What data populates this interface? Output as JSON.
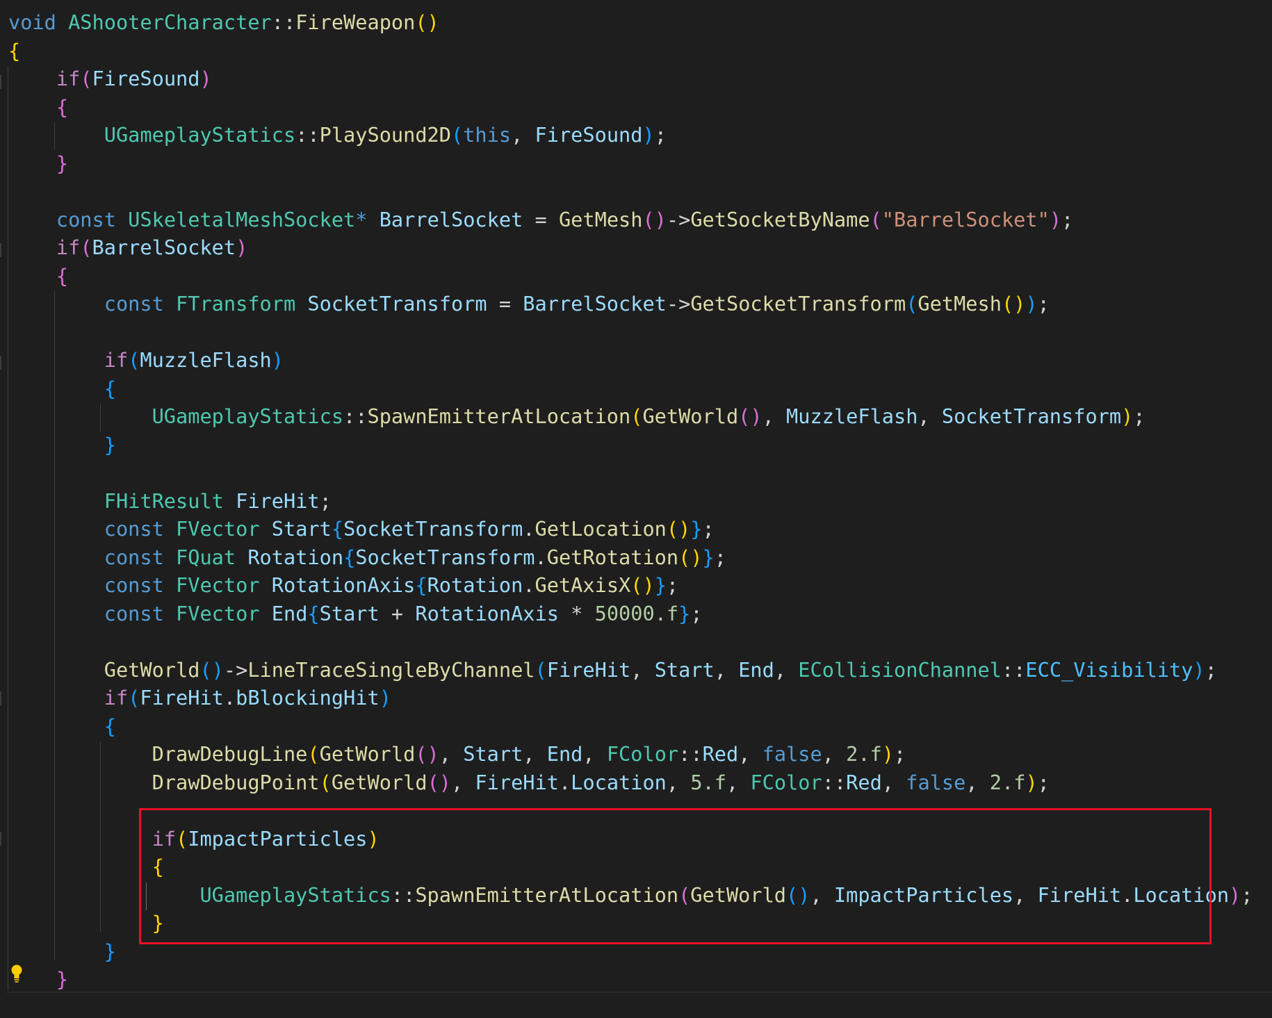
{
  "editor": {
    "theme": "dark",
    "colors": {
      "background": "#1e1e1e",
      "keyword": "#569cd6",
      "control": "#c586c0",
      "type": "#4ec9b0",
      "function": "#dcdcaa",
      "variable": "#9cdcfe",
      "enum_member": "#4fc1ff",
      "string": "#ce9178",
      "number": "#b5cea8",
      "bracket_level_1": "#ffd700",
      "bracket_level_2": "#da70d6",
      "bracket_level_3": "#179fff",
      "highlight_box": "#e81123"
    },
    "highlight_box": {
      "label": "red-highlight-box",
      "first_line": 29,
      "last_line": 32
    },
    "gutter_icon": "lightbulb-icon",
    "lines": [
      [
        [
          "kw",
          "void"
        ],
        [
          "op",
          " "
        ],
        [
          "type",
          "AShooterCharacter"
        ],
        [
          "op",
          "::"
        ],
        [
          "fn",
          "FireWeapon"
        ],
        [
          "b1",
          "()"
        ]
      ],
      [
        [
          "b1",
          "{"
        ]
      ],
      [
        [
          "op",
          "    "
        ],
        [
          "ctl",
          "if"
        ],
        [
          "b2",
          "("
        ],
        [
          "var",
          "FireSound"
        ],
        [
          "b2",
          ")"
        ]
      ],
      [
        [
          "op",
          "    "
        ],
        [
          "b2",
          "{"
        ]
      ],
      [
        [
          "op",
          "        "
        ],
        [
          "type",
          "UGameplayStatics"
        ],
        [
          "op",
          "::"
        ],
        [
          "fn",
          "PlaySound2D"
        ],
        [
          "b3",
          "("
        ],
        [
          "kw",
          "this"
        ],
        [
          "pun",
          ", "
        ],
        [
          "var",
          "FireSound"
        ],
        [
          "b3",
          ")"
        ],
        [
          "pun",
          ";"
        ]
      ],
      [
        [
          "op",
          "    "
        ],
        [
          "b2",
          "}"
        ]
      ],
      [],
      [
        [
          "op",
          "    "
        ],
        [
          "kw",
          "const"
        ],
        [
          "op",
          " "
        ],
        [
          "type",
          "USkeletalMeshSocket"
        ],
        [
          "kw",
          "*"
        ],
        [
          "op",
          " "
        ],
        [
          "var",
          "BarrelSocket"
        ],
        [
          "op",
          " = "
        ],
        [
          "fn",
          "GetMesh"
        ],
        [
          "b2",
          "()"
        ],
        [
          "op",
          "->"
        ],
        [
          "fn",
          "GetSocketByName"
        ],
        [
          "b2",
          "("
        ],
        [
          "str",
          "\"BarrelSocket\""
        ],
        [
          "b2",
          ")"
        ],
        [
          "pun",
          ";"
        ]
      ],
      [
        [
          "op",
          "    "
        ],
        [
          "ctl",
          "if"
        ],
        [
          "b2",
          "("
        ],
        [
          "var",
          "BarrelSocket"
        ],
        [
          "b2",
          ")"
        ]
      ],
      [
        [
          "op",
          "    "
        ],
        [
          "b2",
          "{"
        ]
      ],
      [
        [
          "op",
          "        "
        ],
        [
          "kw",
          "const"
        ],
        [
          "op",
          " "
        ],
        [
          "type",
          "FTransform"
        ],
        [
          "op",
          " "
        ],
        [
          "var",
          "SocketTransform"
        ],
        [
          "op",
          " = "
        ],
        [
          "var",
          "BarrelSocket"
        ],
        [
          "op",
          "->"
        ],
        [
          "fn",
          "GetSocketTransform"
        ],
        [
          "b3",
          "("
        ],
        [
          "fn",
          "GetMesh"
        ],
        [
          "b1",
          "()"
        ],
        [
          "b3",
          ")"
        ],
        [
          "pun",
          ";"
        ]
      ],
      [],
      [
        [
          "op",
          "        "
        ],
        [
          "ctl",
          "if"
        ],
        [
          "b3",
          "("
        ],
        [
          "var",
          "MuzzleFlash"
        ],
        [
          "b3",
          ")"
        ]
      ],
      [
        [
          "op",
          "        "
        ],
        [
          "b3",
          "{"
        ]
      ],
      [
        [
          "op",
          "            "
        ],
        [
          "type",
          "UGameplayStatics"
        ],
        [
          "op",
          "::"
        ],
        [
          "fn",
          "SpawnEmitterAtLocation"
        ],
        [
          "b1",
          "("
        ],
        [
          "fn",
          "GetWorld"
        ],
        [
          "b2",
          "()"
        ],
        [
          "pun",
          ", "
        ],
        [
          "var",
          "MuzzleFlash"
        ],
        [
          "pun",
          ", "
        ],
        [
          "var",
          "SocketTransform"
        ],
        [
          "b1",
          ")"
        ],
        [
          "pun",
          ";"
        ]
      ],
      [
        [
          "op",
          "        "
        ],
        [
          "b3",
          "}"
        ]
      ],
      [],
      [
        [
          "op",
          "        "
        ],
        [
          "type",
          "FHitResult"
        ],
        [
          "op",
          " "
        ],
        [
          "var",
          "FireHit"
        ],
        [
          "pun",
          ";"
        ]
      ],
      [
        [
          "op",
          "        "
        ],
        [
          "kw",
          "const"
        ],
        [
          "op",
          " "
        ],
        [
          "type",
          "FVector"
        ],
        [
          "op",
          " "
        ],
        [
          "var",
          "Start"
        ],
        [
          "b3",
          "{"
        ],
        [
          "var",
          "SocketTransform"
        ],
        [
          "op",
          "."
        ],
        [
          "fn",
          "GetLocation"
        ],
        [
          "b1",
          "()"
        ],
        [
          "b3",
          "}"
        ],
        [
          "pun",
          ";"
        ]
      ],
      [
        [
          "op",
          "        "
        ],
        [
          "kw",
          "const"
        ],
        [
          "op",
          " "
        ],
        [
          "type",
          "FQuat"
        ],
        [
          "op",
          " "
        ],
        [
          "var",
          "Rotation"
        ],
        [
          "b3",
          "{"
        ],
        [
          "var",
          "SocketTransform"
        ],
        [
          "op",
          "."
        ],
        [
          "fn",
          "GetRotation"
        ],
        [
          "b1",
          "()"
        ],
        [
          "b3",
          "}"
        ],
        [
          "pun",
          ";"
        ]
      ],
      [
        [
          "op",
          "        "
        ],
        [
          "kw",
          "const"
        ],
        [
          "op",
          " "
        ],
        [
          "type",
          "FVector"
        ],
        [
          "op",
          " "
        ],
        [
          "var",
          "RotationAxis"
        ],
        [
          "b3",
          "{"
        ],
        [
          "var",
          "Rotation"
        ],
        [
          "op",
          "."
        ],
        [
          "fn",
          "GetAxisX"
        ],
        [
          "b1",
          "()"
        ],
        [
          "b3",
          "}"
        ],
        [
          "pun",
          ";"
        ]
      ],
      [
        [
          "op",
          "        "
        ],
        [
          "kw",
          "const"
        ],
        [
          "op",
          " "
        ],
        [
          "type",
          "FVector"
        ],
        [
          "op",
          " "
        ],
        [
          "var",
          "End"
        ],
        [
          "b3",
          "{"
        ],
        [
          "var",
          "Start"
        ],
        [
          "op",
          " + "
        ],
        [
          "var",
          "RotationAxis"
        ],
        [
          "op",
          " * "
        ],
        [
          "num",
          "50000.f"
        ],
        [
          "b3",
          "}"
        ],
        [
          "pun",
          ";"
        ]
      ],
      [],
      [
        [
          "op",
          "        "
        ],
        [
          "fn",
          "GetWorld"
        ],
        [
          "b3",
          "()"
        ],
        [
          "op",
          "->"
        ],
        [
          "fn",
          "LineTraceSingleByChannel"
        ],
        [
          "b3",
          "("
        ],
        [
          "var",
          "FireHit"
        ],
        [
          "pun",
          ", "
        ],
        [
          "var",
          "Start"
        ],
        [
          "pun",
          ", "
        ],
        [
          "var",
          "End"
        ],
        [
          "pun",
          ", "
        ],
        [
          "type",
          "ECollisionChannel"
        ],
        [
          "op",
          "::"
        ],
        [
          "enumv",
          "ECC_Visibility"
        ],
        [
          "b3",
          ")"
        ],
        [
          "pun",
          ";"
        ]
      ],
      [
        [
          "op",
          "        "
        ],
        [
          "ctl",
          "if"
        ],
        [
          "b3",
          "("
        ],
        [
          "var",
          "FireHit"
        ],
        [
          "op",
          "."
        ],
        [
          "var",
          "bBlockingHit"
        ],
        [
          "b3",
          ")"
        ]
      ],
      [
        [
          "op",
          "        "
        ],
        [
          "b3",
          "{"
        ]
      ],
      [
        [
          "op",
          "            "
        ],
        [
          "fn",
          "DrawDebugLine"
        ],
        [
          "b1",
          "("
        ],
        [
          "fn",
          "GetWorld"
        ],
        [
          "b2",
          "()"
        ],
        [
          "pun",
          ", "
        ],
        [
          "var",
          "Start"
        ],
        [
          "pun",
          ", "
        ],
        [
          "var",
          "End"
        ],
        [
          "pun",
          ", "
        ],
        [
          "type",
          "FColor"
        ],
        [
          "op",
          "::"
        ],
        [
          "var",
          "Red"
        ],
        [
          "pun",
          ", "
        ],
        [
          "kw",
          "false"
        ],
        [
          "pun",
          ", "
        ],
        [
          "num",
          "2.f"
        ],
        [
          "b1",
          ")"
        ],
        [
          "pun",
          ";"
        ]
      ],
      [
        [
          "op",
          "            "
        ],
        [
          "fn",
          "DrawDebugPoint"
        ],
        [
          "b1",
          "("
        ],
        [
          "fn",
          "GetWorld"
        ],
        [
          "b2",
          "()"
        ],
        [
          "pun",
          ", "
        ],
        [
          "var",
          "FireHit"
        ],
        [
          "op",
          "."
        ],
        [
          "var",
          "Location"
        ],
        [
          "pun",
          ", "
        ],
        [
          "num",
          "5.f"
        ],
        [
          "pun",
          ", "
        ],
        [
          "type",
          "FColor"
        ],
        [
          "op",
          "::"
        ],
        [
          "var",
          "Red"
        ],
        [
          "pun",
          ", "
        ],
        [
          "kw",
          "false"
        ],
        [
          "pun",
          ", "
        ],
        [
          "num",
          "2.f"
        ],
        [
          "b1",
          ")"
        ],
        [
          "pun",
          ";"
        ]
      ],
      [],
      [
        [
          "op",
          "            "
        ],
        [
          "ctl",
          "if"
        ],
        [
          "b1",
          "("
        ],
        [
          "var",
          "ImpactParticles"
        ],
        [
          "b1",
          ")"
        ]
      ],
      [
        [
          "op",
          "            "
        ],
        [
          "b1",
          "{"
        ]
      ],
      [
        [
          "op",
          "                "
        ],
        [
          "type",
          "UGameplayStatics"
        ],
        [
          "op",
          "::"
        ],
        [
          "fn",
          "SpawnEmitterAtLocation"
        ],
        [
          "b2",
          "("
        ],
        [
          "fn",
          "GetWorld"
        ],
        [
          "b3",
          "()"
        ],
        [
          "pun",
          ", "
        ],
        [
          "var",
          "ImpactParticles"
        ],
        [
          "pun",
          ", "
        ],
        [
          "var",
          "FireHit"
        ],
        [
          "op",
          "."
        ],
        [
          "var",
          "Location"
        ],
        [
          "b2",
          ")"
        ],
        [
          "pun",
          ";"
        ]
      ],
      [
        [
          "op",
          "            "
        ],
        [
          "b1",
          "}"
        ]
      ],
      [
        [
          "op",
          "        "
        ],
        [
          "b3",
          "}"
        ]
      ],
      [
        [
          "op",
          "    "
        ],
        [
          "b2",
          "}"
        ]
      ]
    ]
  }
}
